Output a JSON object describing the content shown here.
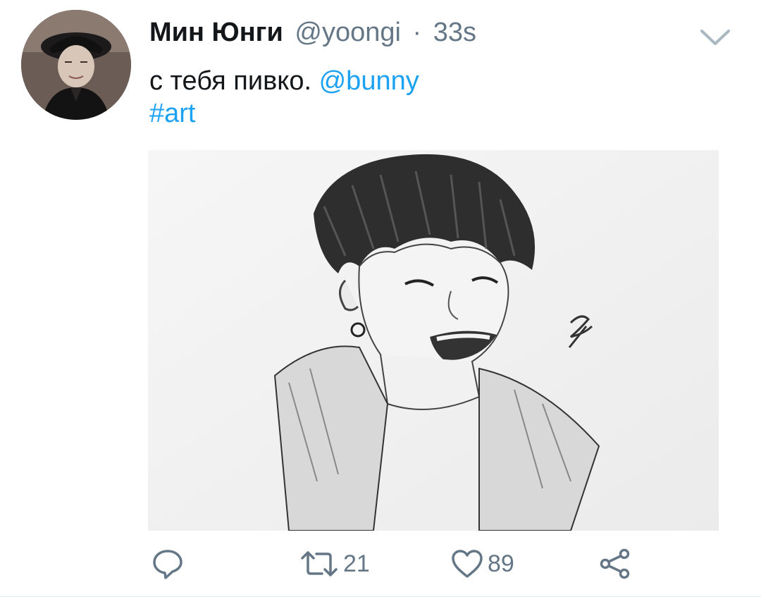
{
  "tweet": {
    "author": {
      "display_name": "Мин Юнги",
      "handle": "@yoongi"
    },
    "separator": "·",
    "time": "33s",
    "text": {
      "main": "с тебя пивко.",
      "mention": "@bunny",
      "hashtag": "#art"
    },
    "media": {
      "kind": "pencil sketch image"
    },
    "actions": {
      "reply_icon": "reply-icon",
      "retweet_icon": "retweet-icon",
      "retweet_count": "21",
      "like_icon": "heart-icon",
      "like_count": "89",
      "share_icon": "share-icon"
    },
    "menu_icon": "chevron-down-icon"
  },
  "colors": {
    "text": "#14171a",
    "secondary": "#657786",
    "link": "#1da1f2",
    "background": "#ffffff"
  }
}
